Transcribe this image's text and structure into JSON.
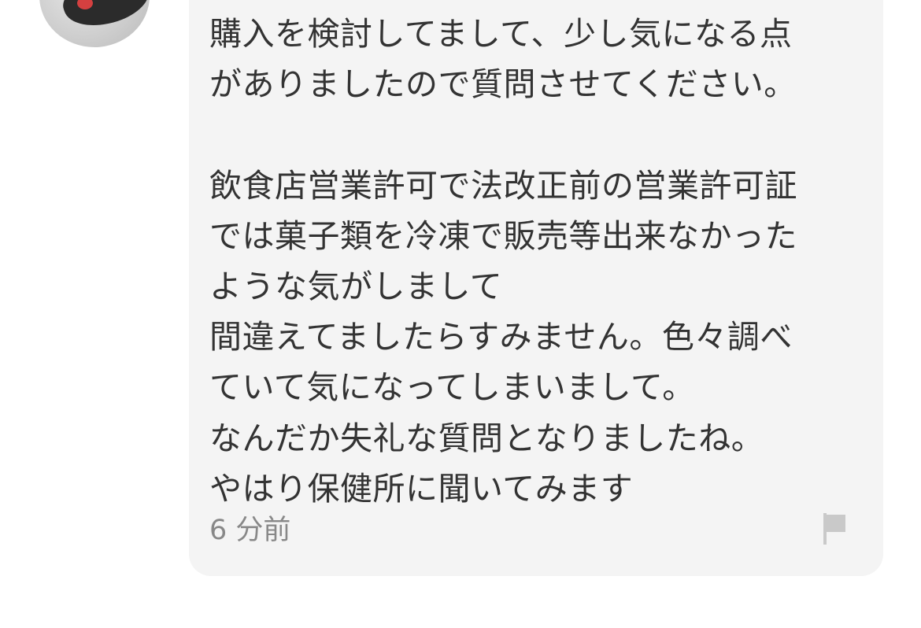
{
  "comment": {
    "avatar_icon": "user-avatar",
    "message_lines": [
      "購入を検討してまして、少し気になる点",
      "がありましたので質問させてください。",
      "",
      "飲食店営業許可で法改正前の営業許可証",
      "では菓子類を冷凍で販売等出来なかった",
      "ような気がしまして",
      "間違えてましたらすみません。色々調べ",
      "ていて気になってしまいまして。",
      "なんだか失礼な質問となりましたね。",
      "やはり保健所に聞いてみます"
    ],
    "timestamp": "6 分前",
    "report_icon": "flag-icon"
  },
  "colors": {
    "bubble_background": "#f4f4f4",
    "text": "#333333",
    "timestamp": "#888888",
    "flag": "#c9c9c9"
  }
}
